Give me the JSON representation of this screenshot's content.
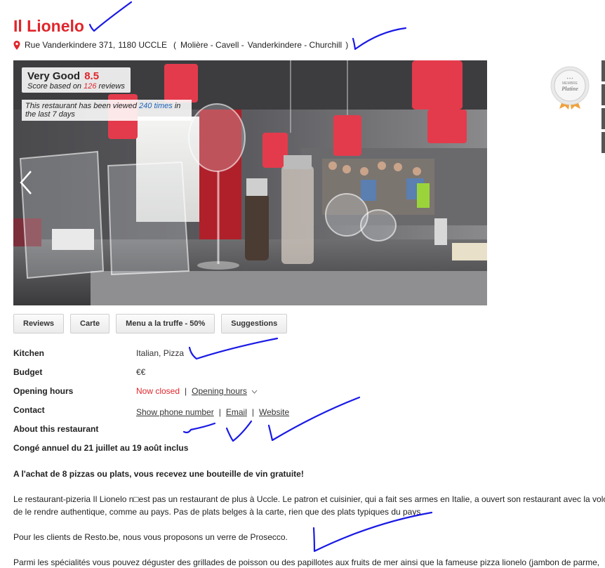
{
  "restaurant": {
    "name": "Il Lionelo",
    "address_street": "Rue Vanderkindere 371,",
    "address_city": "1180 UCCLE",
    "areas_open": "(",
    "area_1": "Molière - Cavell -",
    "area_2": "Vanderkindere - Churchill",
    "areas_close": ")"
  },
  "photo": {
    "rating_label": "Very Good",
    "rating_value": "8.5",
    "score_prefix": "Score based on",
    "review_count": "126",
    "score_suffix": "reviews",
    "views_prefix": "This restaurant has been viewed",
    "views_count": "240 times",
    "views_suffix_1": "in",
    "views_suffix_2": "the last 7 days"
  },
  "badge": {
    "line1": "MEMBRE",
    "line2": "Platine"
  },
  "tabs": [
    "Reviews",
    "Carte",
    "Menu a la truffe - 50%",
    "Suggestions"
  ],
  "details": {
    "kitchen_label": "Kitchen",
    "kitchen_value": "Italian, Pizza",
    "budget_label": "Budget",
    "budget_value": "€€",
    "hours_label": "Opening hours",
    "hours_status": "Now closed",
    "hours_link": "Opening hours",
    "contact_label": "Contact",
    "contact_phone": "Show phone number",
    "contact_email": "Email",
    "contact_website": "Website",
    "about_label": "About this restaurant"
  },
  "about": {
    "closure": "Congé annuel du 21 juillet au 19 août inclus",
    "promo": "A l'achat de 8 pizzas ou plats, vous recevez une bouteille de vin gratuite!",
    "para1_line1": "Le restaurant-pizeria Il Lionelo n□est pas un restaurant de plus à Uccle. Le patron et cuisinier, qui a fait ses armes en Italie, a ouvert son restaurant avec la volonté",
    "para1_line2": "de le rendre authentique, comme au pays. Pas de plats belges à la carte, rien que des plats typiques du pays.",
    "para2": "Pour les clients de Resto.be, nous vous proposons un verre de Prosecco.",
    "para3": "Parmi les spécialités vous pouvez déguster des grillades de poisson ou des papillotes aux fruits de mer ainsi que la fameuse pizza lionelo (jambon de parme,"
  },
  "colors": {
    "brand_red": "#e0262b",
    "annotation_blue": "#1a1ae6",
    "link_blue": "#1d62b5"
  },
  "icons": {
    "pin": "location-pin-icon",
    "prev": "chevron-left-icon",
    "dropdown": "chevron-down-icon"
  }
}
